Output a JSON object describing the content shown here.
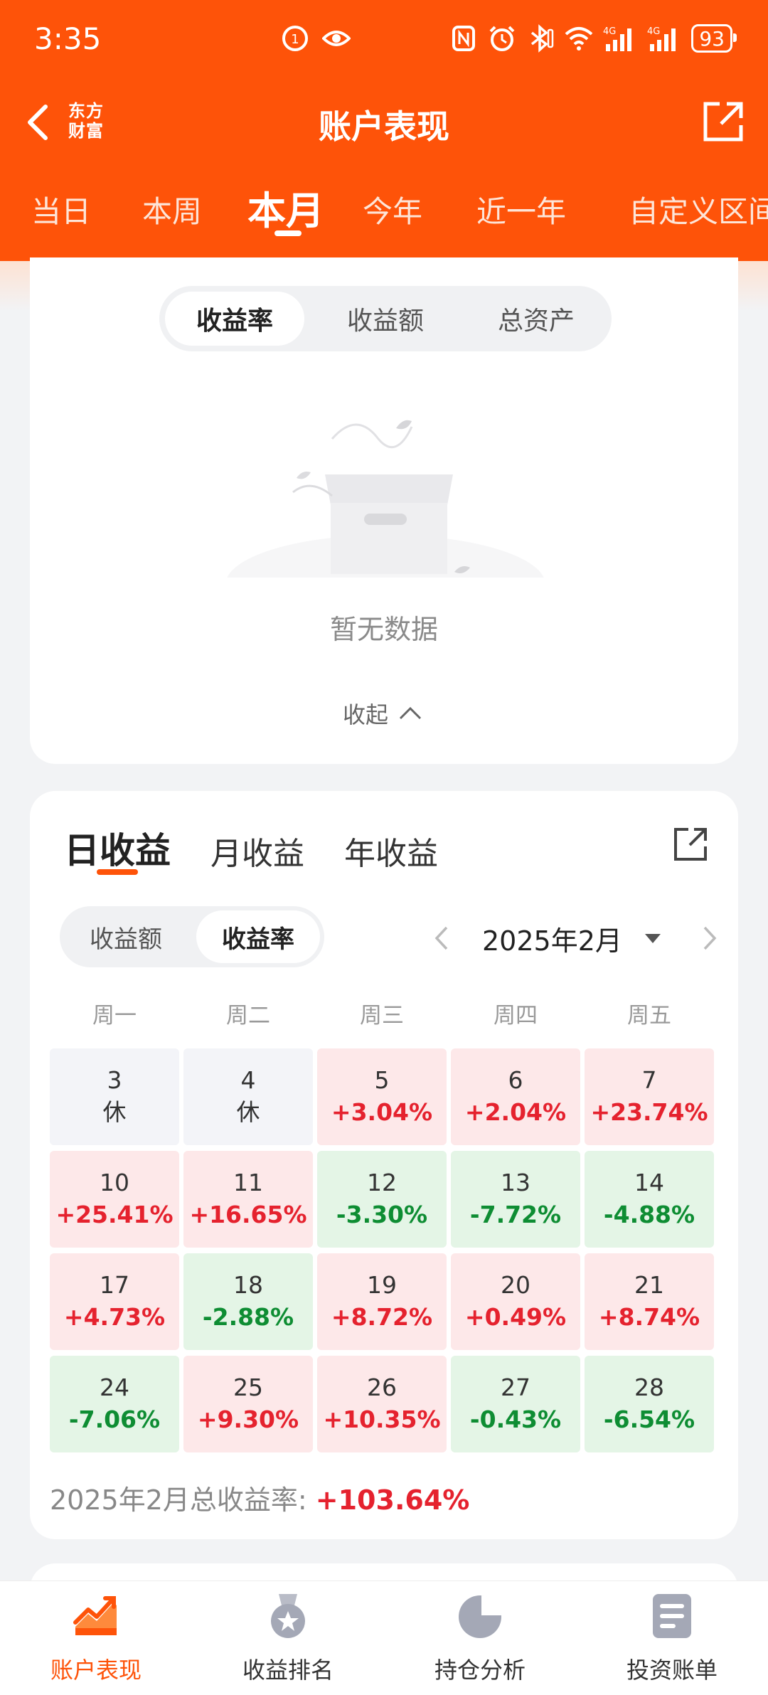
{
  "status_bar": {
    "time": "3:35",
    "battery": "93",
    "left_icons": [
      "app-badge-icon",
      "eye-icon"
    ],
    "right_icons": [
      "nfc-icon",
      "alarm-icon",
      "bluetooth-icon",
      "wifi-icon",
      "signal-4g-icon",
      "signal-4g-icon"
    ]
  },
  "nav": {
    "brand_line1": "东方",
    "brand_line2": "财富",
    "title": "账户表现"
  },
  "period_tabs": [
    "当日",
    "本周",
    "本月",
    "今年",
    "近一年",
    "自定义区间"
  ],
  "period_active": "本月",
  "chart_panel": {
    "segments": [
      "收益率",
      "收益额",
      "总资产"
    ],
    "active_segment": "收益率",
    "empty_text": "暂无数据",
    "collapse_label": "收起"
  },
  "daily": {
    "type_tabs": [
      "日收益",
      "月收益",
      "年收益"
    ],
    "active_type": "日收益",
    "metric_tabs": [
      "收益额",
      "收益率"
    ],
    "active_metric": "收益率",
    "month": "2025年2月",
    "weekdays": [
      "周一",
      "周二",
      "周三",
      "周四",
      "周五"
    ],
    "weeks": [
      [
        {
          "day": "3",
          "value": "休",
          "kind": "rest"
        },
        {
          "day": "4",
          "value": "休",
          "kind": "rest"
        },
        {
          "day": "5",
          "value": "+3.04%",
          "kind": "gain"
        },
        {
          "day": "6",
          "value": "+2.04%",
          "kind": "gain"
        },
        {
          "day": "7",
          "value": "+23.74%",
          "kind": "gain"
        }
      ],
      [
        {
          "day": "10",
          "value": "+25.41%",
          "kind": "gain"
        },
        {
          "day": "11",
          "value": "+16.65%",
          "kind": "gain"
        },
        {
          "day": "12",
          "value": "-3.30%",
          "kind": "loss"
        },
        {
          "day": "13",
          "value": "-7.72%",
          "kind": "loss"
        },
        {
          "day": "14",
          "value": "-4.88%",
          "kind": "loss"
        }
      ],
      [
        {
          "day": "17",
          "value": "+4.73%",
          "kind": "gain"
        },
        {
          "day": "18",
          "value": "-2.88%",
          "kind": "loss"
        },
        {
          "day": "19",
          "value": "+8.72%",
          "kind": "gain"
        },
        {
          "day": "20",
          "value": "+0.49%",
          "kind": "gain"
        },
        {
          "day": "21",
          "value": "+8.74%",
          "kind": "gain"
        }
      ],
      [
        {
          "day": "24",
          "value": "-7.06%",
          "kind": "loss"
        },
        {
          "day": "25",
          "value": "+9.30%",
          "kind": "gain"
        },
        {
          "day": "26",
          "value": "+10.35%",
          "kind": "gain"
        },
        {
          "day": "27",
          "value": "-0.43%",
          "kind": "loss"
        },
        {
          "day": "28",
          "value": "-6.54%",
          "kind": "loss"
        }
      ]
    ],
    "total_label": "2025年2月总收益率:",
    "total_value": "+103.64%"
  },
  "bottom_nav": [
    {
      "label": "账户表现",
      "icon": "chart-trend-icon",
      "active": true
    },
    {
      "label": "收益排名",
      "icon": "medal-icon",
      "active": false
    },
    {
      "label": "持仓分析",
      "icon": "pie-chart-icon",
      "active": false
    },
    {
      "label": "投资账单",
      "icon": "bill-icon",
      "active": false
    }
  ],
  "colors": {
    "brand": "#fe5309",
    "gain_text": "#e5222e",
    "loss_text": "#0e8d33",
    "gain_bg": "#fde8e9",
    "loss_bg": "#e4f5e6"
  }
}
